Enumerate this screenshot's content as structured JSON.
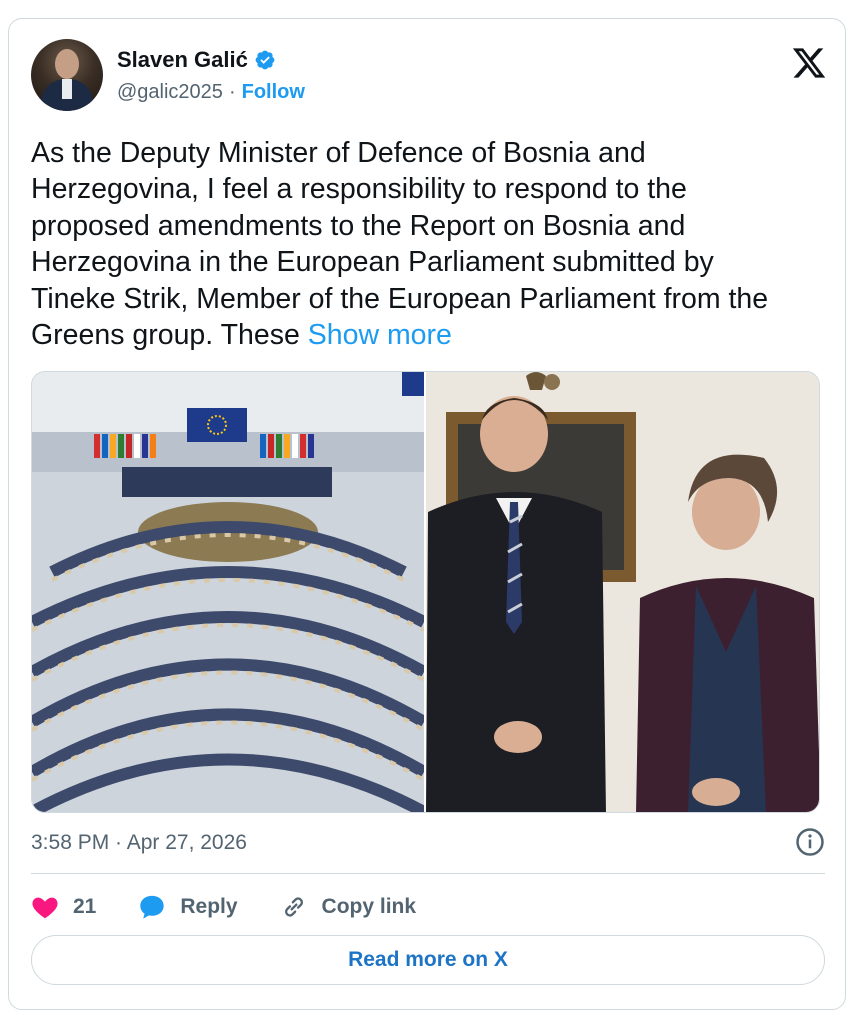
{
  "author": {
    "name": "Slaven Galić",
    "handle": "@galic2025",
    "separator": "·",
    "follow_label": "Follow"
  },
  "tweet": {
    "text": "As the Deputy Minister of Defence of Bosnia and\nHerzegovina, I feel a responsibility to respond to the\nproposed amendments to the Report on Bosnia and\nHerzegovina in the European Parliament submitted by\nTineke Strik, Member of the European Parliament from the\nGreens group. These ",
    "show_more": "Show more"
  },
  "media": {
    "left_image": "parliament-hemicycle-photo",
    "right_image": "two-people-standing-photo"
  },
  "meta": {
    "timestamp": "3:58 PM · Apr 27, 2026"
  },
  "actions": {
    "like_count": "21",
    "reply_label": "Reply",
    "copy_link_label": "Copy link"
  },
  "footer": {
    "read_more_label": "Read more on X"
  },
  "colors": {
    "accent": "#1d9bf0",
    "like": "#f91880",
    "text": "#0f1419",
    "muted": "#536471",
    "border": "#cfd9de"
  },
  "icons": [
    "verified-badge-icon",
    "x-logo-icon",
    "info-icon",
    "heart-icon",
    "reply-bubble-icon",
    "link-icon"
  ]
}
